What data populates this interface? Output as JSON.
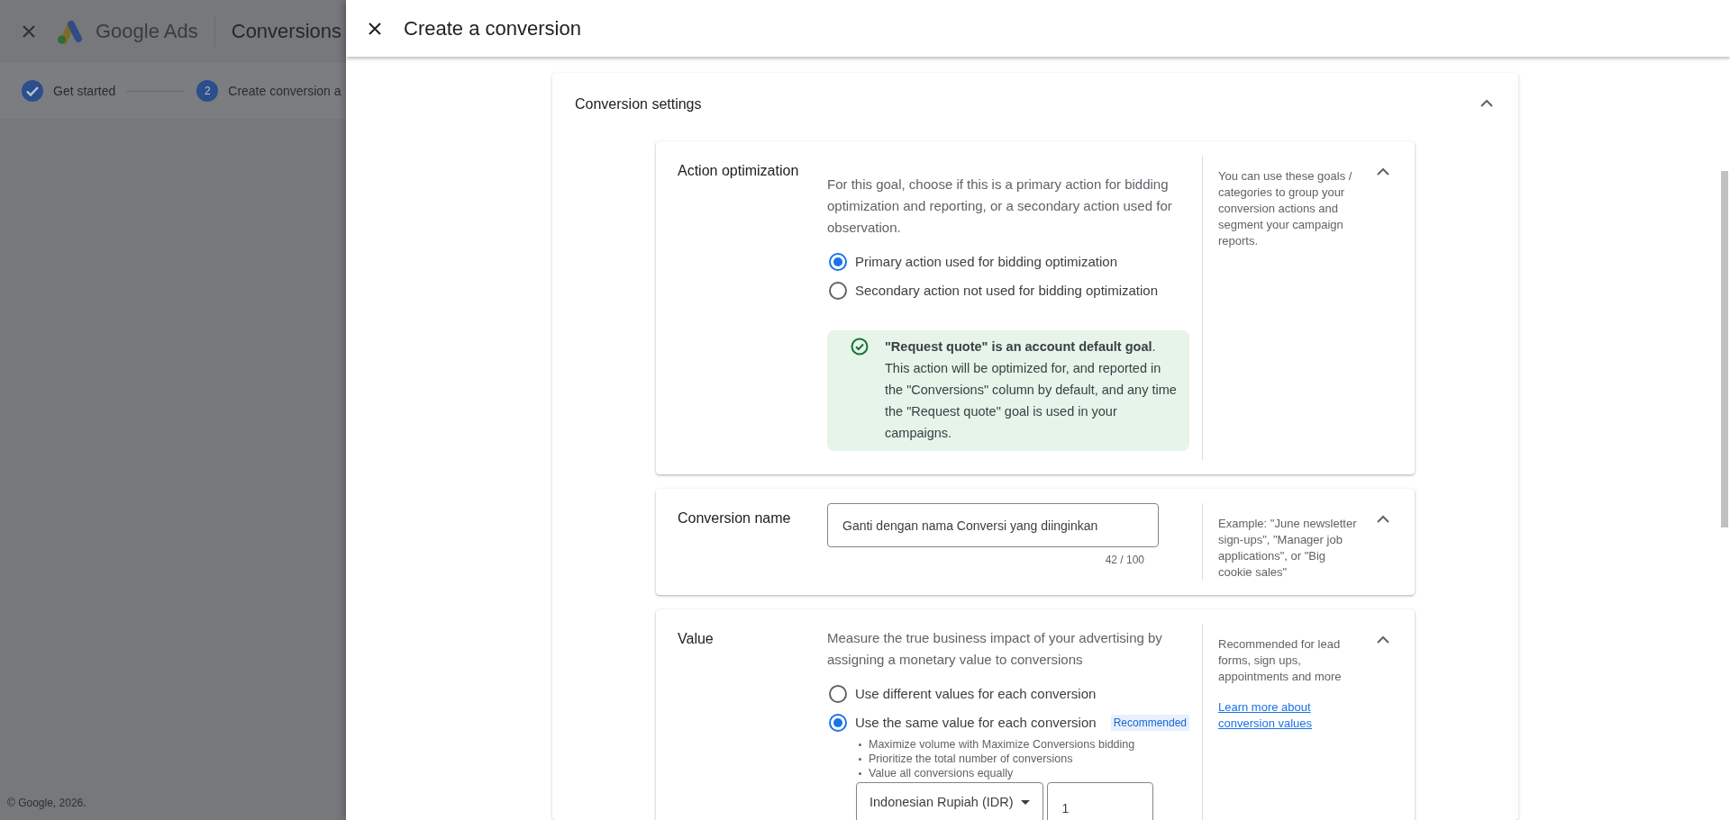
{
  "background_page": {
    "app_name": "Google Ads",
    "page_title": "Conversions",
    "steps": [
      {
        "label": "Get started",
        "done": true
      },
      {
        "label": "Create conversion a",
        "number": "2",
        "done": false
      }
    ],
    "footer": "© Google, 2026."
  },
  "dialog": {
    "title": "Create a conversion"
  },
  "settings": {
    "title": "Conversion settings",
    "expanded": true
  },
  "sections": [
    {
      "kind": "radio",
      "title": "Action optimization",
      "expanded": true,
      "description": "For this goal, choose if this is a primary action for bidding optimization and reporting, or a secondary action used for observation.",
      "options": [
        {
          "label": "Primary action used for bidding optimization",
          "selected": true
        },
        {
          "label": "Secondary action not used for bidding optimization",
          "selected": false
        }
      ],
      "notice": "**\"Request quote\" is an account default goal**. This action will be optimized for, and reported in the \"Conversions\" column by default, and any time the \"Request quote\" goal is used in your campaigns.",
      "help": "You can use these goals / categories to group your conversion actions and segment your campaign reports."
    },
    {
      "kind": "text_field",
      "title": "Conversion name",
      "expanded": true,
      "value": "Ganti dengan nama Conversi yang diinginkan",
      "counter": "42 / 100",
      "help": "Example: \"June newsletter sign-ups\", \"Manager job applications\", or \"Big cookie sales\""
    },
    {
      "kind": "value",
      "title": "Value",
      "expanded": true,
      "description": "Measure the true business impact of your advertising by assigning a monetary value to conversions",
      "options": [
        {
          "label": "Use different values for each conversion",
          "selected": false
        },
        {
          "label": "Use the same value for each conversion",
          "selected": true,
          "badge": "Recommended",
          "bullets": [
            "Maximize volume with Maximize Conversions bidding",
            "Prioritize the total number of conversions",
            "Value all conversions equally"
          ]
        }
      ],
      "currency": "Indonesian Rupiah (IDR)",
      "amount": "1",
      "help": "Recommended for lead forms, sign ups, appointments and more",
      "help_link": "Learn more about conversion values"
    }
  ]
}
